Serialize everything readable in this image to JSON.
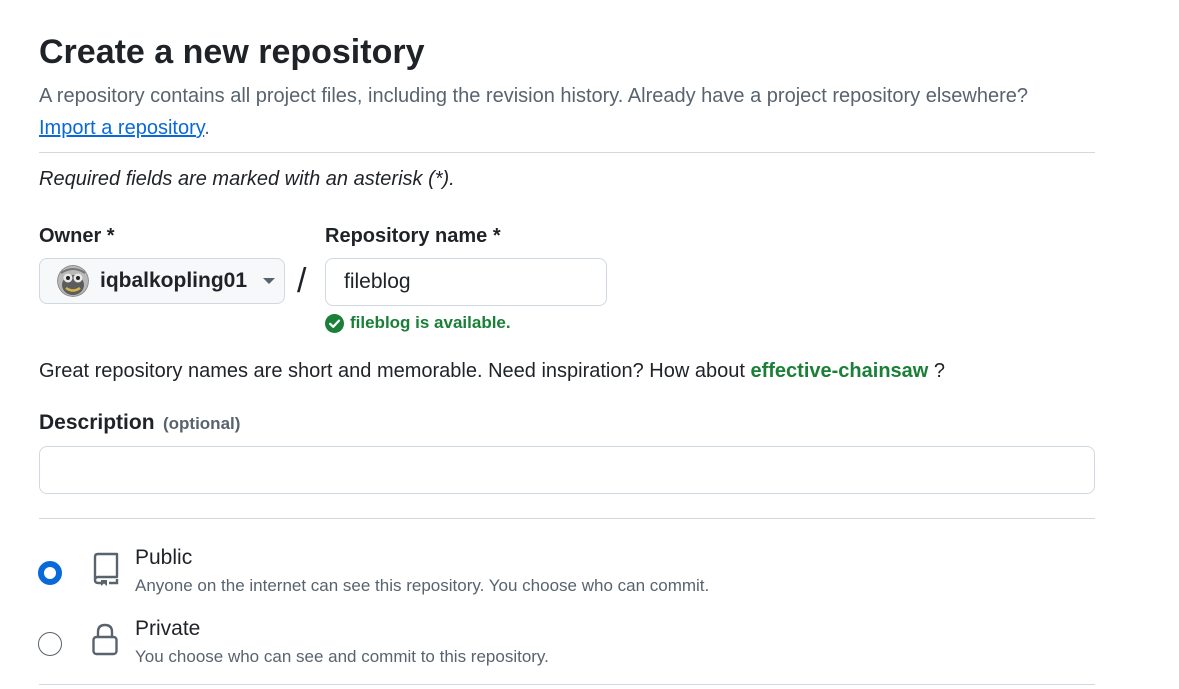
{
  "header": {
    "title": "Create a new repository",
    "subtitle_text": "A repository contains all project files, including the revision history. Already have a project repository elsewhere?",
    "import_link": "Import a repository",
    "import_suffix": "."
  },
  "form": {
    "required_note": "Required fields are marked with an asterisk (*).",
    "owner": {
      "label": "Owner *",
      "value": "iqbalkopling01",
      "avatar_icon": "avatar-icon",
      "caret_icon": "caret-down-icon"
    },
    "separator": "/",
    "repo_name": {
      "label": "Repository name *",
      "value": "fileblog",
      "availability": "fileblog is available.",
      "availability_icon": "check-circle-icon"
    },
    "inspiration": {
      "text": "Great repository names are short and memorable. Need inspiration? How about ",
      "suggestion": "effective-chainsaw",
      "suffix": " ?"
    },
    "description": {
      "label": "Description",
      "optional": "(optional)",
      "value": "",
      "placeholder": ""
    },
    "visibility": [
      {
        "title": "Public",
        "desc": "Anyone on the internet can see this repository. You choose who can commit.",
        "icon": "repo-icon",
        "selected": true
      },
      {
        "title": "Private",
        "desc": "You choose who can see and commit to this repository.",
        "icon": "lock-icon",
        "selected": false
      }
    ]
  },
  "colors": {
    "accent": "#0969da",
    "success": "#1a7f37",
    "text": "#1f2328",
    "muted": "#59636e",
    "border": "#d1d9e0"
  }
}
